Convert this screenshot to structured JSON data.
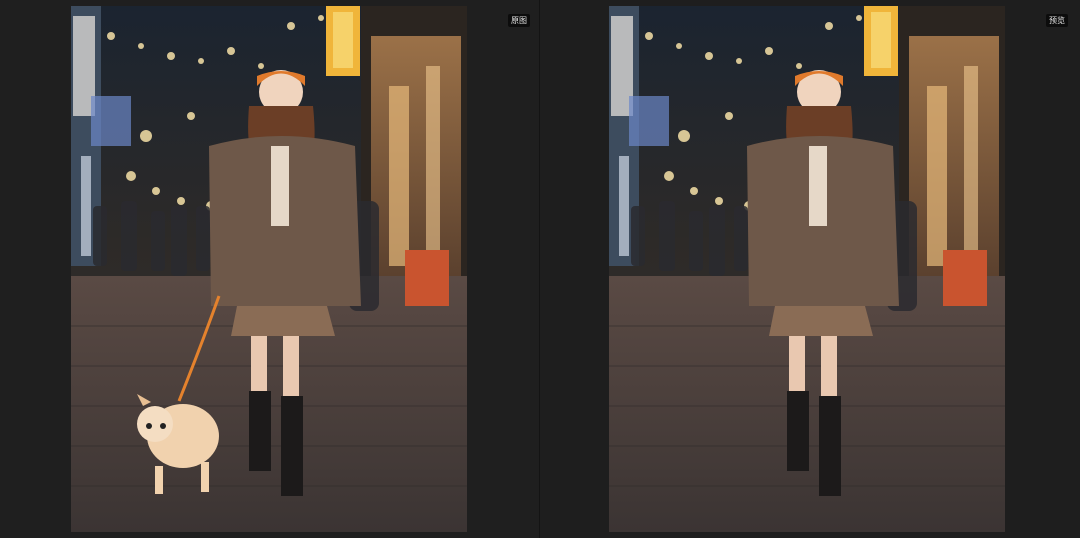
{
  "panes": [
    {
      "label": "原图",
      "has_dog": true
    },
    {
      "label": "预览",
      "has_dog": false
    }
  ],
  "colors": {
    "background": "#222222",
    "label_bg": "#0c0c0c",
    "label_text": "#e6e6e6"
  }
}
